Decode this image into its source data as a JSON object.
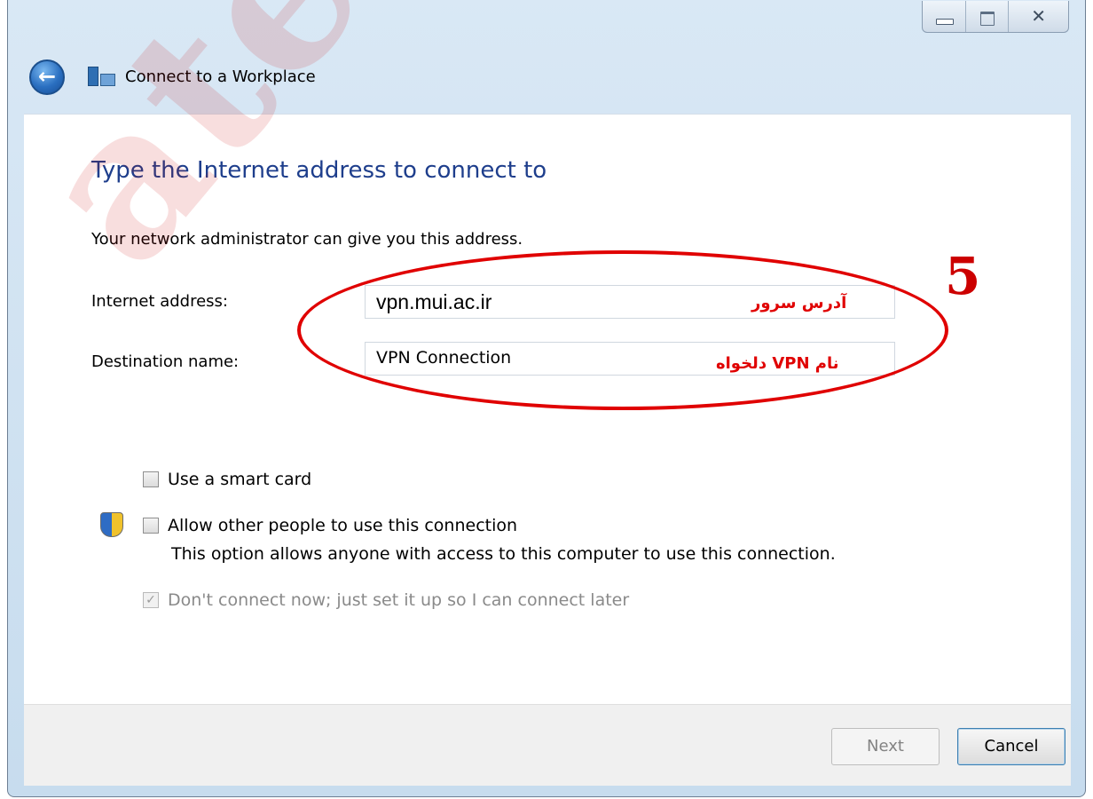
{
  "window": {
    "title": "Connect to a Workplace",
    "close_glyph": "✕",
    "back_glyph": "←"
  },
  "main": {
    "heading": "Type the Internet address to connect to",
    "description": "Your network administrator can give you this address.",
    "internet_address_label": "Internet address:",
    "internet_address_value": "vpn.mui.ac.ir",
    "destination_name_label": "Destination name:",
    "destination_name_value": "VPN Connection",
    "use_smart_card_label": "Use a smart card",
    "allow_others_label": "Allow other people to use this connection",
    "allow_others_note": "This option allows anyone with access to this computer to use this connection.",
    "dont_connect_label": "Don't connect now; just set it up so I can connect later",
    "dont_connect_checked": true
  },
  "annotations": {
    "server_address_note": "آدرس سرور",
    "vpn_name_note": "نام VPN دلخواه",
    "step_number": "5",
    "watermark": "ated in Mast",
    "highlight_color": "#e00000"
  },
  "footer": {
    "next_label": "Next",
    "cancel_label": "Cancel"
  },
  "icons": [
    "back-arrow-icon",
    "connect-workplace-icon",
    "uac-shield-icon",
    "minimize-icon",
    "maximize-icon",
    "close-icon"
  ]
}
